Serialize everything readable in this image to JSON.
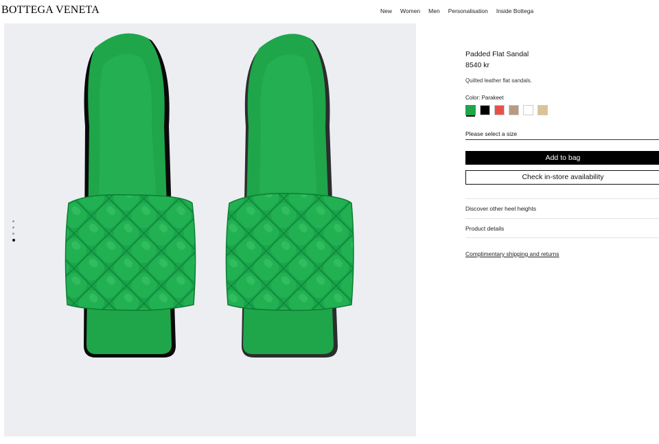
{
  "brand": {
    "logo_text": "BOTTEGA VENETA"
  },
  "nav": {
    "items": [
      "New",
      "Women",
      "Men",
      "Personalisation",
      "Inside Bottega"
    ]
  },
  "product": {
    "title": "Padded Flat Sandal",
    "price": "8540 kr",
    "description": "Quilted leather flat sandals.",
    "color_label": "Color: Parakeet",
    "swatches": [
      "#1fa64a",
      "#000000",
      "#e8514a",
      "#b89a84",
      "#ffffff",
      "#dcc394"
    ],
    "selected_swatch": 0,
    "size_placeholder": "Please select a size",
    "add_to_bag": "Add to bag",
    "check_store": "Check in-store availability",
    "accordion": [
      "Discover other heel heights",
      "Product details"
    ],
    "shipping_link": "Complimentary shipping and returns"
  },
  "gallery": {
    "image_count": 4,
    "active_index": 3
  },
  "colors": {
    "product_green": "#1fa64a",
    "image_bg": "#eceef1"
  }
}
